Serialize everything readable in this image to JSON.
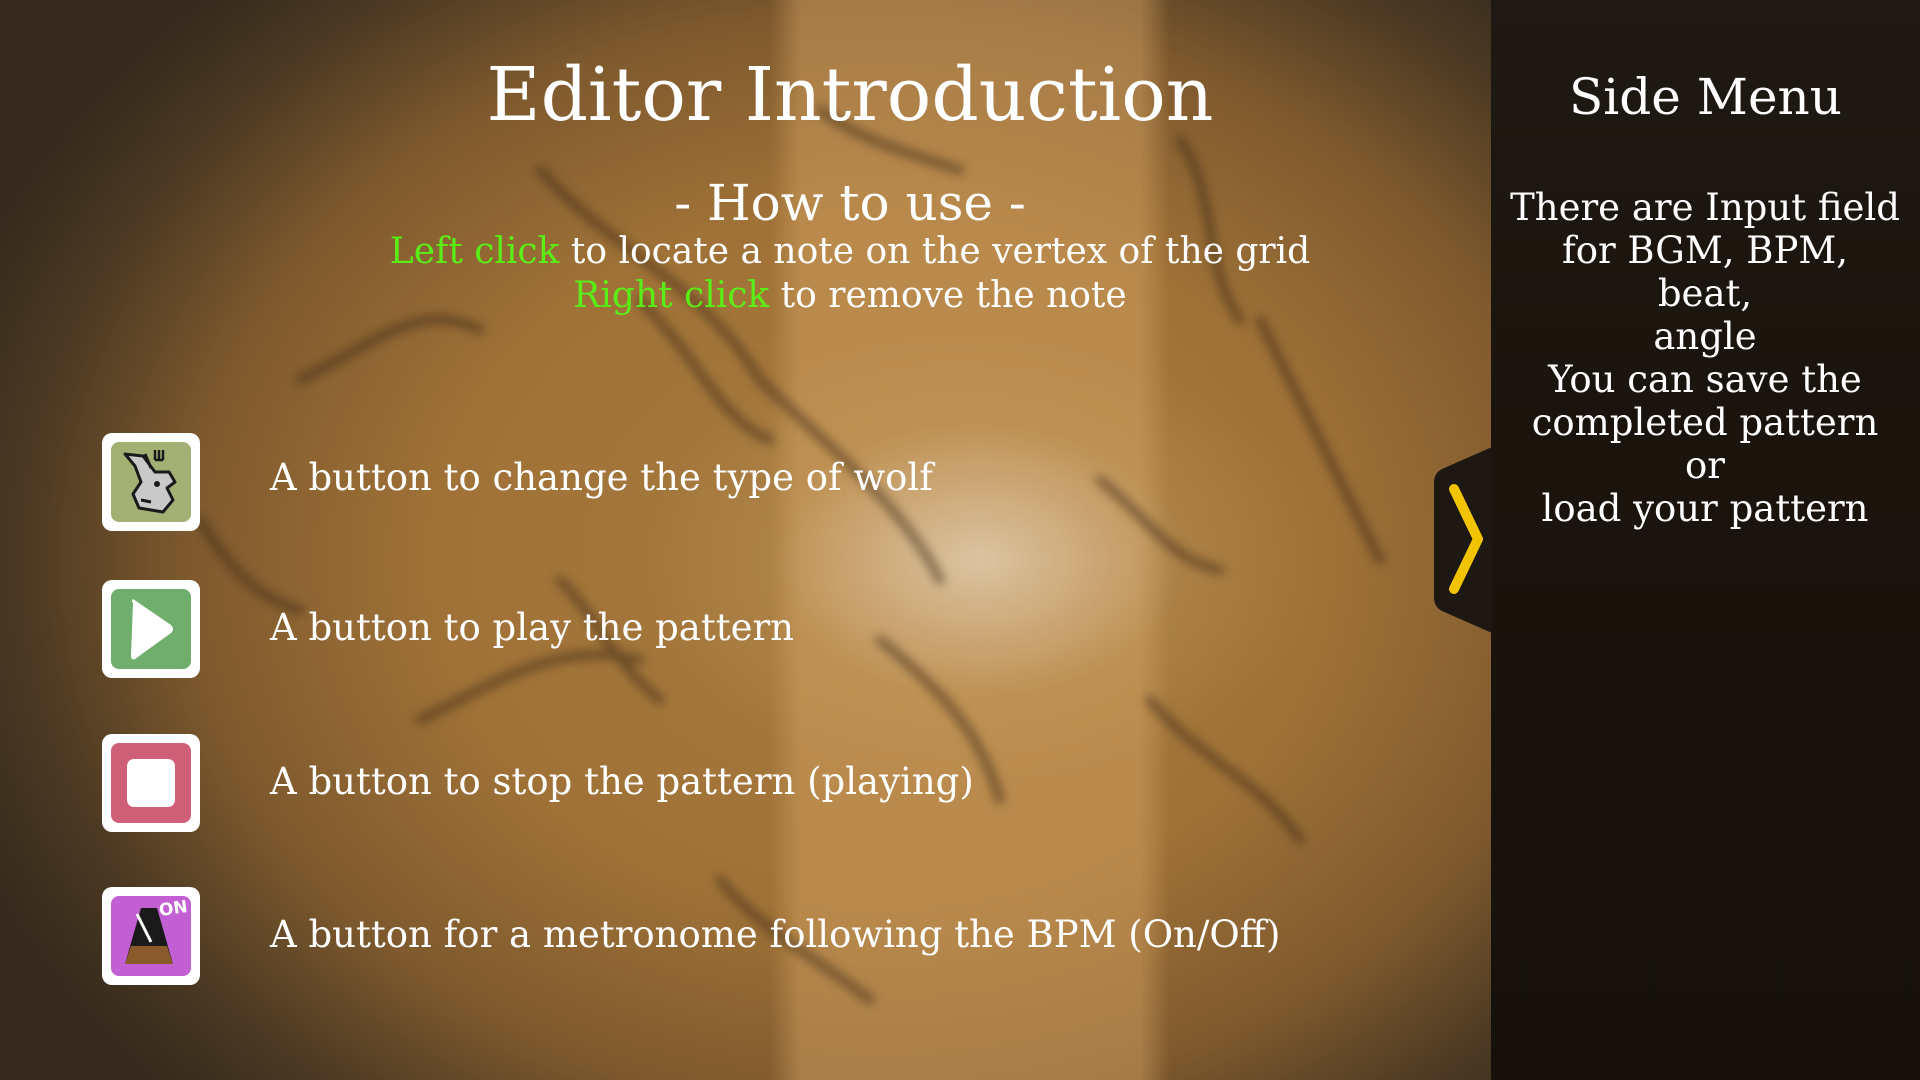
{
  "page_title": "Editor Introduction",
  "how_to_use": {
    "heading": "- How to use -",
    "left_click": {
      "highlight": "Left click",
      "rest": " to locate a note on the vertex of the grid"
    },
    "right_click": {
      "highlight": "Right click",
      "rest": " to remove the note"
    }
  },
  "buttons": [
    {
      "icon": "wolf-icon",
      "description": "A button to change the type of wolf"
    },
    {
      "icon": "play-icon",
      "description": "A button to play the pattern"
    },
    {
      "icon": "stop-icon",
      "description": "A button to stop the pattern (playing)"
    },
    {
      "icon": "metronome-icon",
      "badge": "ON",
      "description": "A button for a metronome following the BPM (On/Off)"
    }
  ],
  "side_menu": {
    "title": "Side Menu",
    "paragraph1": [
      "There are Input field",
      "for BGM, BPM, beat,",
      "angle"
    ],
    "paragraph2": [
      "You can save the",
      "completed pattern",
      "or",
      "load your pattern"
    ],
    "toggle_icon": "chevron-right-icon"
  },
  "colors": {
    "highlight_green": "#5bed18",
    "chevron_yellow": "#f2c400",
    "play_green": "#6fae6d",
    "stop_pink": "#cf5f77",
    "metronome_purple": "#c25fd2",
    "wolf_olive": "#a3b073"
  }
}
